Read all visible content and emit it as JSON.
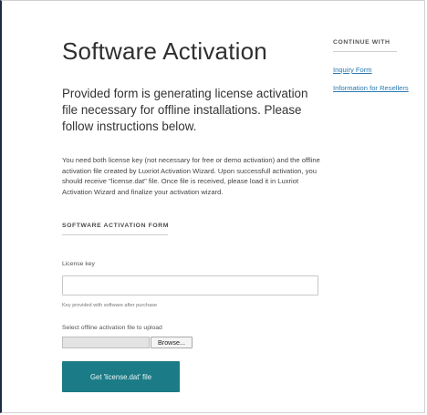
{
  "main": {
    "title": "Software Activation",
    "intro": "Provided form is generating license activation file necessary for offline installations. Please follow instructions below.",
    "description": "You need both license key (not necessary for free or demo activation) and the offline activation file created by Luxriot Activation Wizard. Upon successfull activation, you should receive \"license.dat\" file. Once file is received, please load it in Luxriot Activation Wizard and finalize your activation wizard."
  },
  "form": {
    "section_title": "SOFTWARE ACTIVATION FORM",
    "license_label": "License key",
    "license_value": "",
    "license_hint": "Key provided with software after purchase",
    "file_label": "Select offline activation file to upload",
    "browse_label": "Browse...",
    "submit_label": "Get 'license.dat' file"
  },
  "sidebar": {
    "title": "CONTINUE WITH",
    "links": [
      {
        "label": "Inquiry Form"
      },
      {
        "label": "Information for Resellers"
      }
    ]
  },
  "colors": {
    "accent": "#1b7b86",
    "link": "#2a7ab0"
  }
}
